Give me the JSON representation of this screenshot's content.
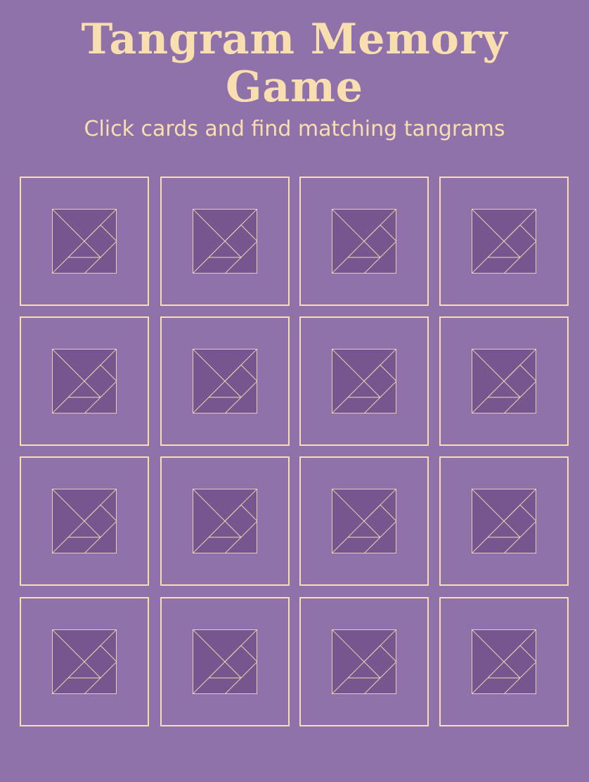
{
  "game": {
    "title_line1": "Tangram Memory",
    "title_line2": "Game",
    "subtitle": "Click cards and find matching tangrams"
  },
  "colors": {
    "background": "#8f72a9",
    "accent": "#f9dfb0",
    "card_back_fill": "#77568f",
    "card_back_line": "#f2d9b4"
  },
  "cards": [
    {
      "state": "face-down",
      "icon": "tangram-icon"
    },
    {
      "state": "face-down",
      "icon": "tangram-icon"
    },
    {
      "state": "face-down",
      "icon": "tangram-icon"
    },
    {
      "state": "face-down",
      "icon": "tangram-icon"
    },
    {
      "state": "face-down",
      "icon": "tangram-icon"
    },
    {
      "state": "face-down",
      "icon": "tangram-icon"
    },
    {
      "state": "face-down",
      "icon": "tangram-icon"
    },
    {
      "state": "face-down",
      "icon": "tangram-icon"
    },
    {
      "state": "face-down",
      "icon": "tangram-icon"
    },
    {
      "state": "face-down",
      "icon": "tangram-icon"
    },
    {
      "state": "face-down",
      "icon": "tangram-icon"
    },
    {
      "state": "face-down",
      "icon": "tangram-icon"
    },
    {
      "state": "face-down",
      "icon": "tangram-icon"
    },
    {
      "state": "face-down",
      "icon": "tangram-icon"
    },
    {
      "state": "face-down",
      "icon": "tangram-icon"
    },
    {
      "state": "face-down",
      "icon": "tangram-icon"
    }
  ]
}
